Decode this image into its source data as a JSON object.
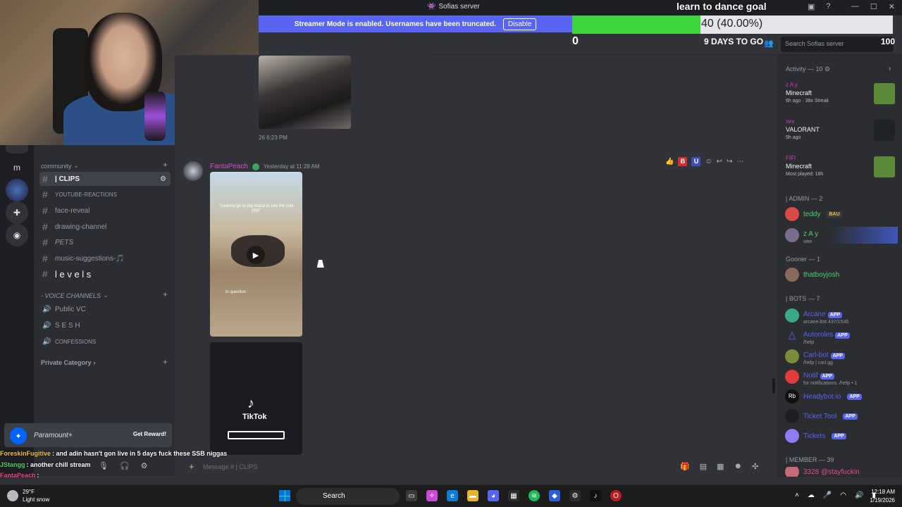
{
  "titlebar": {
    "server_title": "Sofias server",
    "icon": "discord-server-icon"
  },
  "banner": {
    "text": "Streamer Mode is enabled. Usernames have been truncated.",
    "button": "Disable"
  },
  "goal": {
    "title": "learn to dance goal",
    "progress": 0.4,
    "progress_text": "40 (40.00%)",
    "min": "0",
    "days": "9 DAYS TO GO",
    "max": "100"
  },
  "header": {
    "search_placeholder": "Search Sofias server"
  },
  "rail": {
    "items": [
      "m"
    ]
  },
  "sidebar": {
    "category_community": "community",
    "channels": [
      {
        "name": "| CLIPS",
        "active": true
      },
      {
        "name": "YOUTUBE-REACTIONS"
      },
      {
        "name": "face-reveal"
      },
      {
        "name": "drawing-channel"
      },
      {
        "name": "PETS"
      },
      {
        "name": "music-suggestions-🎵"
      },
      {
        "name": "l e v e l s"
      }
    ],
    "category_voice": "- VOICE CHANNELS",
    "voice": [
      "Public VC",
      "S E S H",
      "CONFESSIONS"
    ],
    "category_private": "Private Category"
  },
  "chat": {
    "prev_time": "26 6:23 PM",
    "author": "FantaPeach",
    "timestamp": "Yesterday at 11:28 AM",
    "video1_caption": "\"i wanna go to pig island to see the cute pigs\"",
    "video1_caption2": "in question",
    "tiktok_label": "TikTok",
    "composer_placeholder": "Message # | CLIPS"
  },
  "activity": {
    "header": "Activity — 10",
    "cards": [
      {
        "user": "z A y",
        "game": "Minecraft",
        "meta": "6h ago · 38x Streak",
        "art_color": "#5d8a3a"
      },
      {
        "user": "sex",
        "game": "VALORANT",
        "meta": "5h ago",
        "art_color": "#1f2326"
      },
      {
        "user": "FIFI",
        "game": "Minecraft",
        "meta": "Most played: 18h",
        "art_color": "#5d8a3a"
      }
    ]
  },
  "members": {
    "admin_header": "| ADMIN — 2",
    "admins": [
      {
        "name": "teddy",
        "tag": "BAU",
        "color": "#49d16a"
      },
      {
        "name": "z A y",
        "sub": "wtw",
        "color": "#49d16a"
      }
    ],
    "gooner_header": "Gooner — 1",
    "gooners": [
      {
        "name": "thatboyjosh",
        "color": "#49d16a"
      }
    ],
    "bots_header": "| BOTS — 7",
    "bots": [
      {
        "name": "Arcane",
        "sub": "arcane.bot 437/1536",
        "color": "#5865f2"
      },
      {
        "name": "Autoroles",
        "sub": "/help",
        "color": "#5865f2"
      },
      {
        "name": "Carl-bot",
        "sub": "/help | carl.gg",
        "color": "#5865f2"
      },
      {
        "name": "Notif",
        "sub": "for notifications. /help • 1",
        "color": "#5865f2"
      },
      {
        "name": "Headybot.io",
        "sub": "",
        "color": "#5865f2"
      },
      {
        "name": "Ticket Tool",
        "sub": "",
        "color": "#5865f2"
      },
      {
        "name": "Tickets",
        "sub": "",
        "color": "#5865f2"
      }
    ],
    "app_label": "APP",
    "member_header": "| MEMBER — 39",
    "members": [
      {
        "name": "3328 @stayfuckin",
        "color": "#e64a8d"
      }
    ]
  },
  "ad": {
    "brand": "Paramount+",
    "button": "Get Reward!"
  },
  "stream_chat": [
    {
      "user": "ForeskinFugitive",
      "color": "#f0c040",
      "text": ": and adin hasn't gon live in 5 days fuck these SSB niggas"
    },
    {
      "user": "JStangg",
      "color": "#49d16a",
      "text": ": another chill stream"
    },
    {
      "user": "FantaPeach",
      "color": "#e64a8d",
      "text": ":"
    }
  ],
  "taskbar": {
    "weather_temp": "29°F",
    "weather_desc": "Light snow",
    "search_label": "Search",
    "time": "12:18 AM",
    "date": "1/19/2026"
  }
}
